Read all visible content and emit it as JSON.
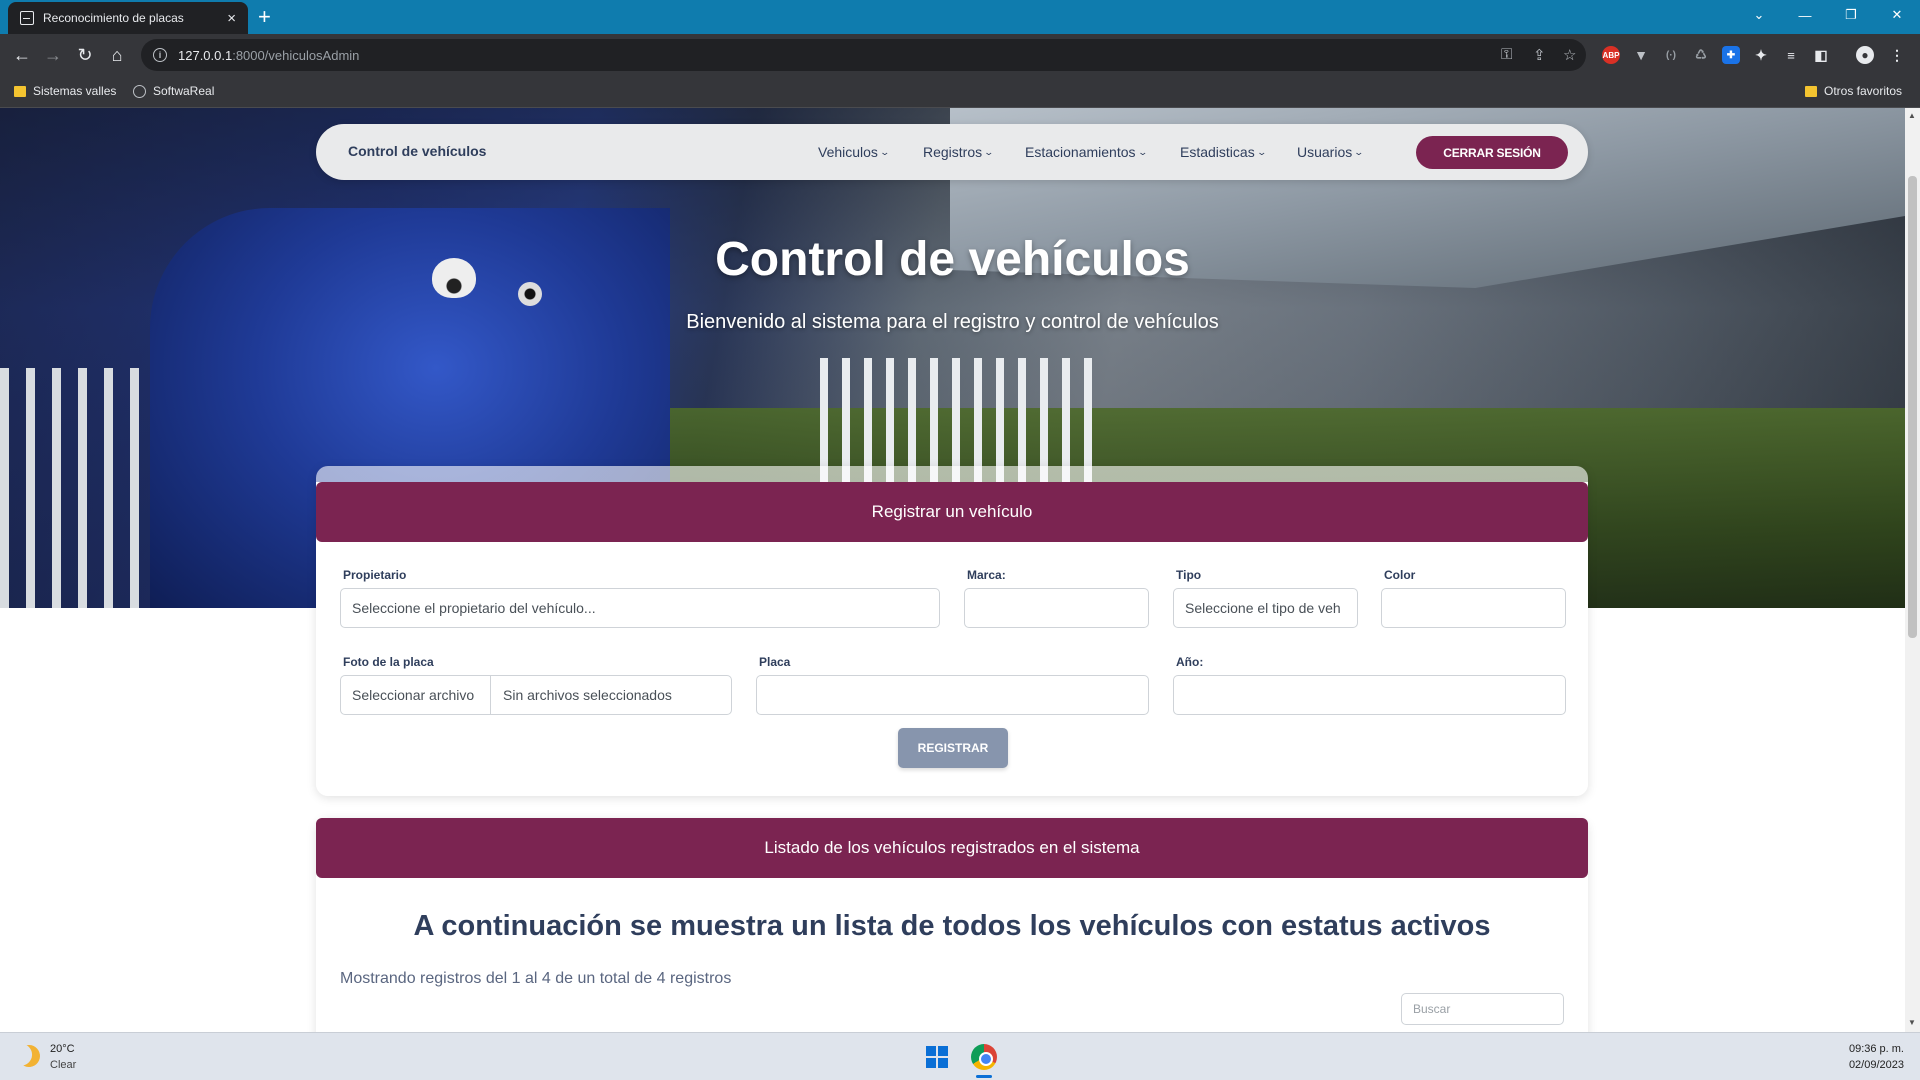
{
  "browser": {
    "tab_title": "Reconocimiento de placas",
    "tab_close": "×",
    "new_tab": "+",
    "url_host": "127.0.0.1",
    "url_path": ":8000/vehiculosAdmin",
    "window_controls": {
      "dropdown": "⌄",
      "minimize": "—",
      "restore": "❐",
      "close": "✕"
    },
    "bookmarks": [
      "Sistemas valles",
      "SoftwaReal"
    ],
    "other_bookmarks": "Otros favoritos",
    "extension_abp": "ABP"
  },
  "nav": {
    "brand": "Control de vehículos",
    "menu": [
      "Vehiculos",
      "Registros",
      "Estacionamientos",
      "Estadisticas",
      "Usuarios"
    ],
    "logout": "CERRAR SESIÓN"
  },
  "hero": {
    "title": "Control de vehículos",
    "subtitle": "Bienvenido al sistema para el registro y control de vehículos"
  },
  "register_form": {
    "header": "Registrar un vehículo",
    "labels": {
      "propietario": "Propietario",
      "marca": "Marca:",
      "tipo": "Tipo",
      "color": "Color",
      "foto": "Foto de la placa",
      "placa": "Placa",
      "anio": "Año:"
    },
    "values": {
      "propietario": "Seleccione el propietario del vehículo...",
      "marca": "",
      "tipo": "Seleccione el tipo de veh",
      "color": "",
      "placa": "",
      "anio": ""
    },
    "file_button": "Seleccionar archivo",
    "file_status": "Sin archivos seleccionados",
    "submit": "REGISTRAR"
  },
  "list": {
    "header": "Listado de los vehículos registrados en el sistema",
    "title": "A continuación se muestra un lista de todos los vehículos con estatus activos",
    "info": "Mostrando registros del 1 al 4 de un total de 4 registros",
    "search_placeholder": "Buscar"
  },
  "taskbar": {
    "temperature": "20°C",
    "condition": "Clear",
    "time": "09:36 p. m.",
    "date": "02/09/2023"
  },
  "colors": {
    "accent": "#7b2451",
    "navy_text": "#2f3e5c",
    "submit_bg": "#8795ad",
    "chrome_tabbar": "#0f7cae"
  }
}
